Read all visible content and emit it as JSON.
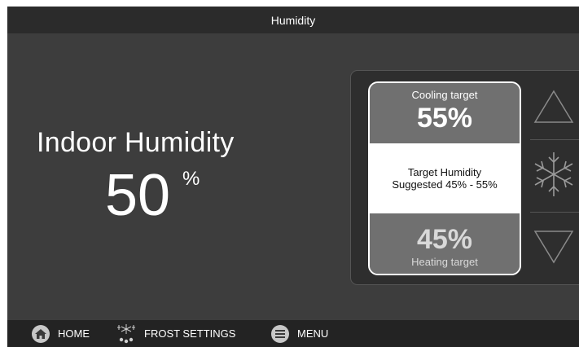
{
  "header": {
    "title": "Humidity"
  },
  "indoor": {
    "label": "Indoor Humidity",
    "value": "50",
    "unit": "%"
  },
  "targets": {
    "cooling_label": "Cooling target",
    "cooling_value": "55%",
    "center_title": "Target Humidity",
    "center_suggestion": "Suggested 45% - 55%",
    "heating_value": "45%",
    "heating_label": "Heating target"
  },
  "controls": {
    "up_icon": "triangle-up-icon",
    "mode_icon": "snowflake-icon",
    "down_icon": "triangle-down-icon"
  },
  "nav": {
    "home_label": "HOME",
    "frost_label": "FROST SETTINGS",
    "menu_label": "MENU"
  }
}
